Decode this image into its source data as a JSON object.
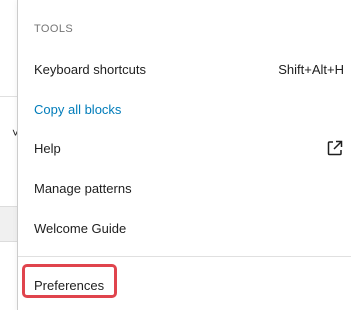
{
  "menu": {
    "section_label": "TOOLS",
    "items": [
      {
        "label": "Keyboard shortcuts",
        "shortcut": "Shift+Alt+H"
      },
      {
        "label": "Copy all blocks"
      },
      {
        "label": "Help",
        "icon": "external-link-icon"
      },
      {
        "label": "Manage patterns"
      },
      {
        "label": "Welcome Guide"
      }
    ],
    "preferences": {
      "label": "Preferences",
      "highlight_color": "#e0444d"
    }
  },
  "colors": {
    "link": "#007cba",
    "text": "#1e1e1e",
    "muted": "#757575",
    "divider": "#e0e0e0"
  }
}
